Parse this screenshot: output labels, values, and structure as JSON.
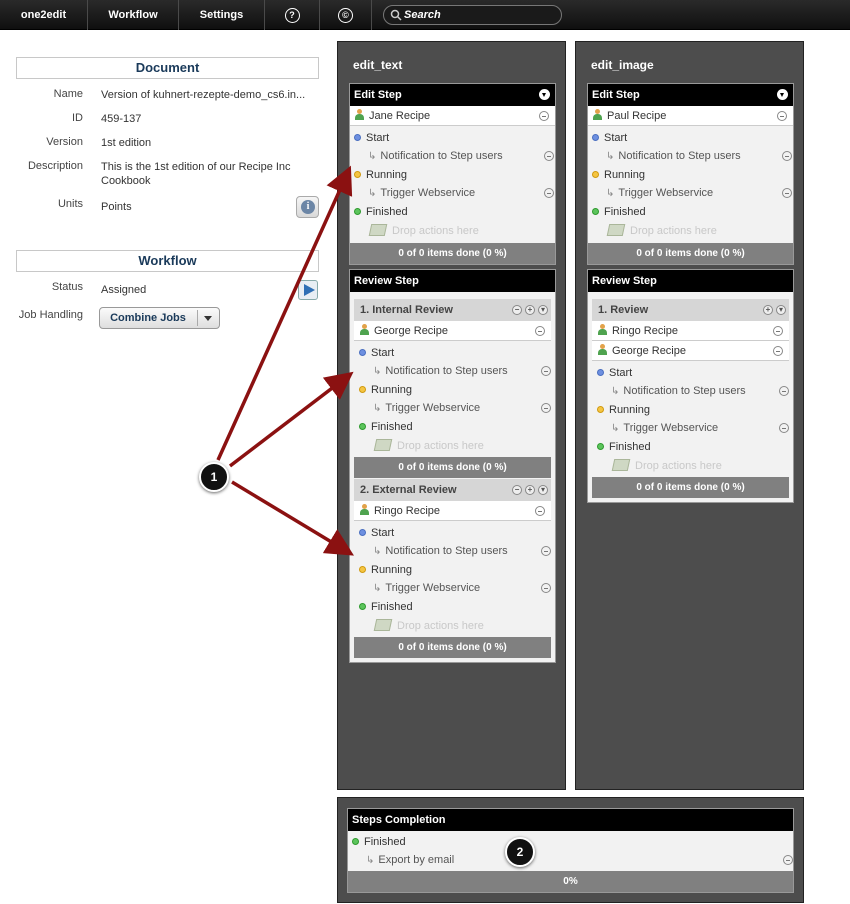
{
  "menu": {
    "app": "one2edit",
    "workflow": "Workflow",
    "settings": "Settings",
    "help_glyph": "?",
    "copyright_glyph": "©",
    "search_placeholder": "Search"
  },
  "document": {
    "header": "Document",
    "name_label": "Name",
    "name_value": "Version of kuhnert-rezepte-demo_cs6.in...",
    "id_label": "ID",
    "id_value": "459-137",
    "version_label": "Version",
    "version_value": "1st edition",
    "description_label": "Description",
    "description_value": "This is the 1st edition of our Recipe Inc Cookbook",
    "units_label": "Units",
    "units_value": "Points"
  },
  "workflow": {
    "header": "Workflow",
    "status_label": "Status",
    "status_value": "Assigned",
    "job_handling_label": "Job Handling",
    "job_handling_value": "Combine Jobs"
  },
  "labels": {
    "start": "Start",
    "running": "Running",
    "finished": "Finished",
    "notify": "Notification to Step users",
    "webservice": "Trigger Webservice",
    "drop": "Drop actions here",
    "items_done": "0 of 0 items done (0 %)"
  },
  "edit_text": {
    "title": "edit_text",
    "edit_step": {
      "title": "Edit Step",
      "user": "Jane Recipe"
    },
    "review_step": {
      "title": "Review Step",
      "internal": {
        "title": "1. Internal Review",
        "user": "George Recipe"
      },
      "external": {
        "title": "2. External Review",
        "user": "Ringo Recipe"
      }
    }
  },
  "edit_image": {
    "title": "edit_image",
    "edit_step": {
      "title": "Edit Step",
      "user": "Paul Recipe"
    },
    "review_step": {
      "title": "Review Step",
      "review": {
        "title": "1. Review",
        "user1": "Ringo Recipe",
        "user2": "George Recipe"
      }
    }
  },
  "completion": {
    "title": "Steps Completion",
    "finished": "Finished",
    "export": "Export by email",
    "progress": "0%"
  },
  "callouts": {
    "one": "1",
    "two": "2"
  },
  "colors": {
    "arrow": "#8b1111",
    "column_bg": "#4d4d4d",
    "header_bg": "#000000"
  }
}
